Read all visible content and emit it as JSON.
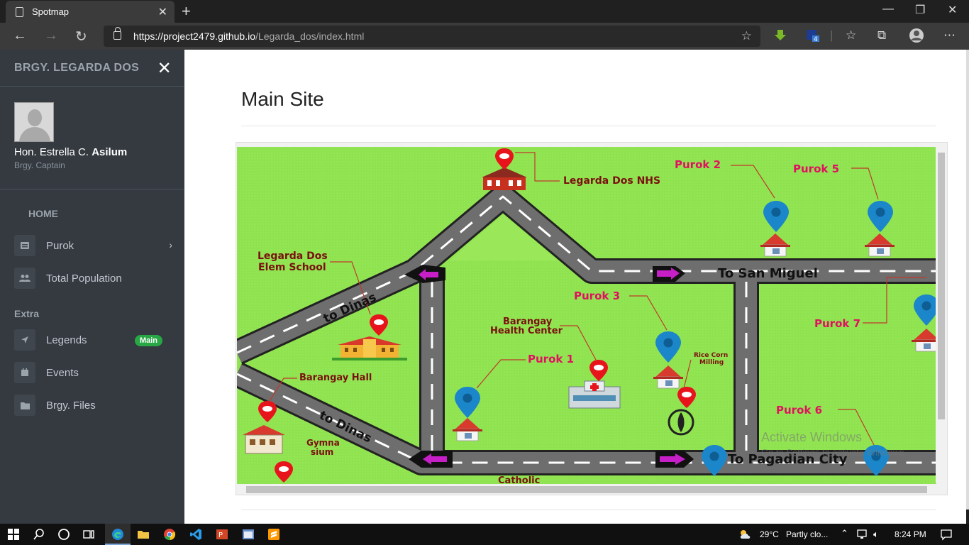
{
  "browser": {
    "tab_title": "Spotmap",
    "url_host": "https://project2479.github.io",
    "url_path": "/Legarda_dos/index.html",
    "ext_badge": "4"
  },
  "sidebar": {
    "brand": "BRGY. LEGARDA DOS",
    "user_name_first": "Hon. Estrella C.",
    "user_name_last": "Asilum",
    "user_role": "Brgy. Captain",
    "home_header": "HOME",
    "extra_header": "Extra",
    "items": [
      {
        "label": "Purok",
        "icon": "home-icon"
      },
      {
        "label": "Total Population",
        "icon": "users-icon"
      },
      {
        "label": "Legends",
        "icon": "location-arrow-icon",
        "badge": "Main"
      },
      {
        "label": "Events",
        "icon": "calendar-icon"
      },
      {
        "label": "Brgy. Files",
        "icon": "folder-icon"
      }
    ]
  },
  "main": {
    "title": "Main Site"
  },
  "map": {
    "labels": {
      "nhs": "Legarda Dos NHS",
      "purok2": "Purok 2",
      "purok5": "Purok 5",
      "elem_line1": "Legarda Dos",
      "elem_line2": "Elem School",
      "to_dinas1": "to Dinas",
      "to_dinas2": "to Dinas",
      "to_san_miguel": "To San Miguel",
      "purok3": "Purok 3",
      "purok7": "Purok 7",
      "health_line1": "Barangay",
      "health_line2": "Health Center",
      "rice_line1": "Rice Corn",
      "rice_line2": "Milling",
      "purok1": "Purok 1",
      "brgy_hall": "Barangay Hall",
      "purok6": "Purok 6",
      "gym_line1": "Gymna",
      "gym_line2": "sium",
      "to_pagadian": "To Pagadian City",
      "catholic": "Catholic"
    },
    "colors": {
      "grass": "#8fe34f",
      "road": "#6e6e6e",
      "label": "#e0115f",
      "dark_label": "#7a1010",
      "pin_red": "#e8141c",
      "pin_blue": "#1b86c9"
    }
  },
  "watermark": {
    "line1": "Activate Windows",
    "line2": "Go to Settings to activate Windows."
  },
  "taskbar": {
    "temp": "29°C",
    "weather": "Partly clo...",
    "time": "8:24 PM"
  }
}
